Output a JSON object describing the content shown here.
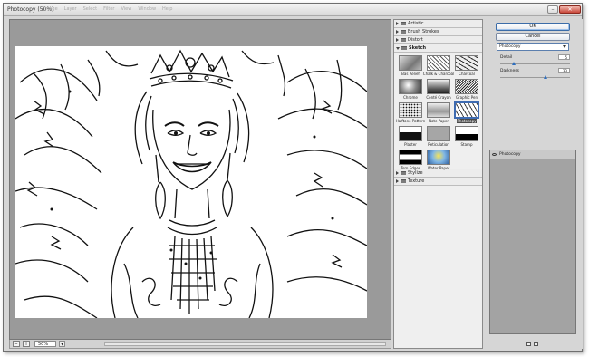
{
  "window": {
    "title": "Photocopy (50%)",
    "ghost_menu": [
      "Image",
      "Layer",
      "Select",
      "Filter",
      "View",
      "Window",
      "Help"
    ]
  },
  "preview": {
    "zoom": "50%",
    "zoom_out": "–",
    "zoom_in": "+"
  },
  "gallery": {
    "categories_top": [
      {
        "name": "Artistic"
      },
      {
        "name": "Brush Strokes"
      },
      {
        "name": "Distort"
      }
    ],
    "open_category": {
      "name": "Sketch"
    },
    "thumbnails": [
      {
        "label": "Bas Relief"
      },
      {
        "label": "Chalk & Charcoal"
      },
      {
        "label": "Charcoal"
      },
      {
        "label": "Chrome"
      },
      {
        "label": "Conté Crayon"
      },
      {
        "label": "Graphic Pen"
      },
      {
        "label": "Halftone Pattern"
      },
      {
        "label": "Note Paper"
      },
      {
        "label": "Photocopy"
      },
      {
        "label": "Plaster"
      },
      {
        "label": "Reticulation"
      },
      {
        "label": "Stamp"
      },
      {
        "label": "Torn Edges"
      },
      {
        "label": "Water Paper"
      }
    ],
    "selected": "Photocopy",
    "categories_bottom": [
      {
        "name": "Stylize"
      },
      {
        "name": "Texture"
      }
    ]
  },
  "settings": {
    "ok_label": "OK",
    "cancel_label": "Cancel",
    "filter_select": "Photocopy",
    "detail": {
      "label": "Detail",
      "value": "5",
      "fraction": 0.2
    },
    "darkness": {
      "label": "Darkness",
      "value": "33",
      "fraction": 0.66
    },
    "layer_name": "Photocopy"
  }
}
